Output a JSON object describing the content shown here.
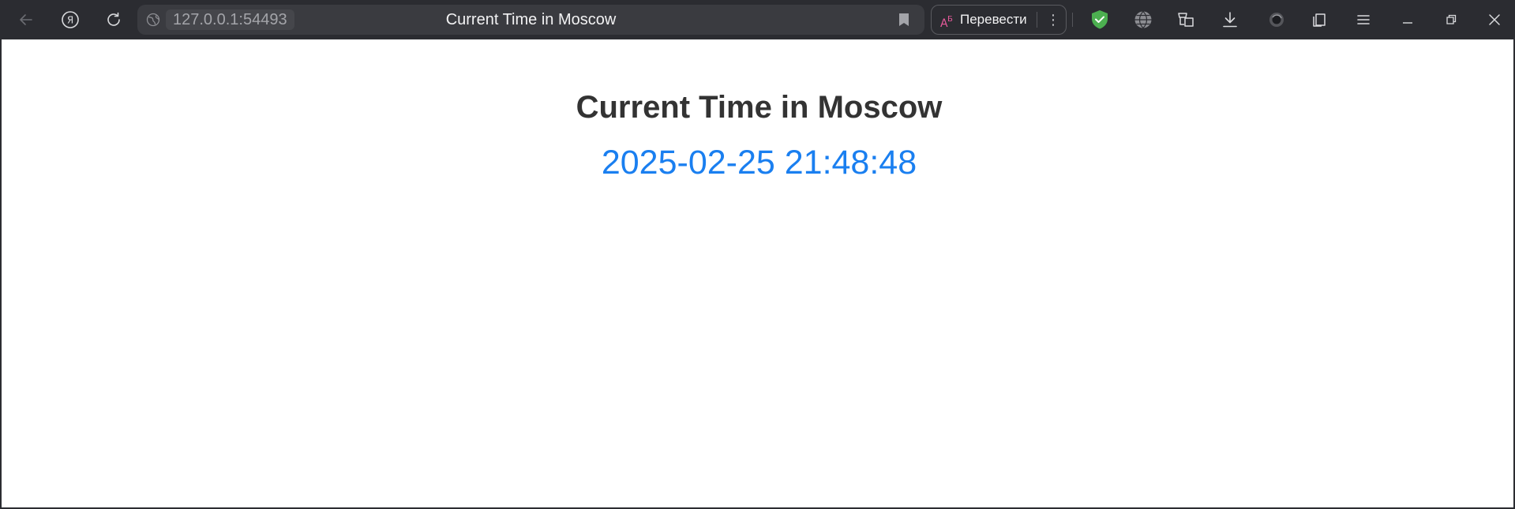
{
  "browser": {
    "address": "127.0.0.1:54493",
    "tab_title": "Current Time in Moscow",
    "translate_label": "Перевести",
    "toolbar_icons": [
      "back-icon",
      "yandex-icon",
      "reload-icon",
      "site-info-icon",
      "bookmark-icon",
      "translate-icon",
      "more-icon",
      "protect-shield-icon",
      "vpn-globe-icon",
      "collections-icon",
      "download-icon",
      "alice-icon",
      "tabs-icon",
      "menu-icon",
      "minimize-icon",
      "restore-icon",
      "close-icon"
    ]
  },
  "page": {
    "heading": "Current Time in Moscow",
    "time": "2025-02-25 21:48:48"
  },
  "colors": {
    "toolbar": "#2b2c31",
    "heading": "#333333",
    "time": "#1a7ff0",
    "shield": "#4caf50"
  }
}
